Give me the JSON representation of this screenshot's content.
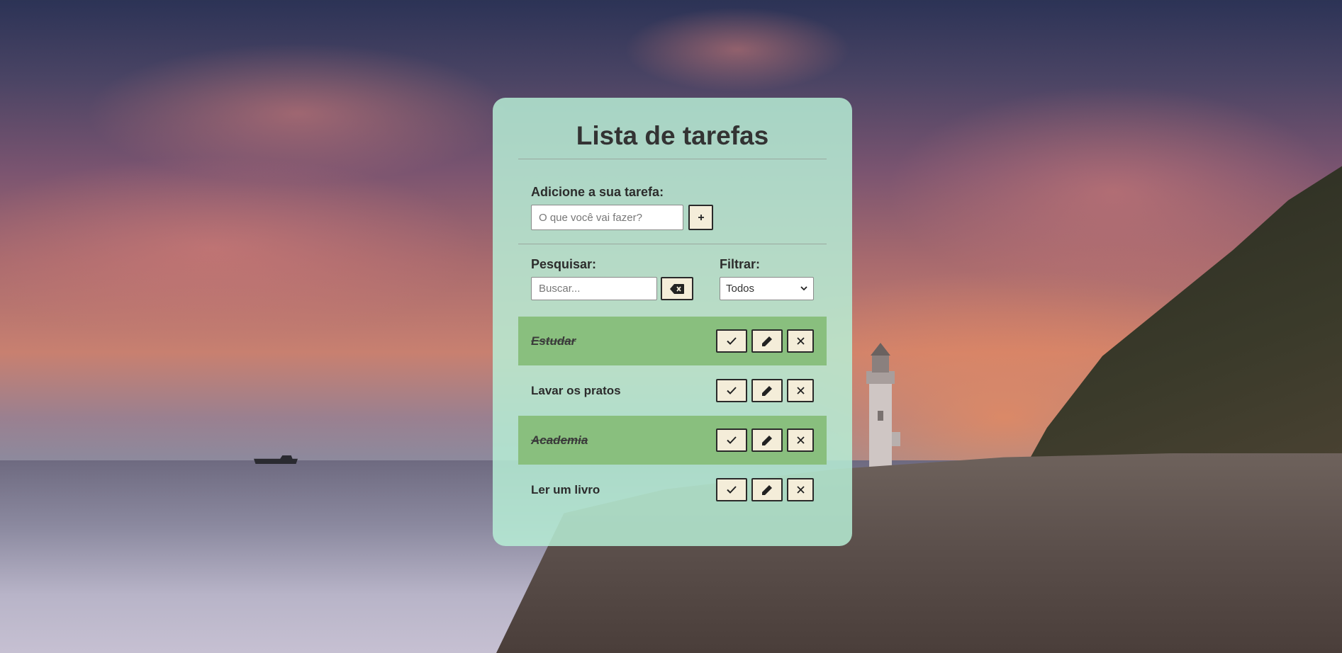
{
  "app": {
    "title": "Lista de tarefas"
  },
  "add_form": {
    "label": "Adicione a sua tarefa:",
    "placeholder": "O que você vai fazer?",
    "value": "",
    "submit_icon": "plus-icon"
  },
  "search": {
    "label": "Pesquisar:",
    "placeholder": "Buscar...",
    "value": "",
    "clear_icon": "erase-icon"
  },
  "filter": {
    "label": "Filtrar:",
    "selected": "Todos"
  },
  "todos": [
    {
      "text": "Estudar",
      "done": true
    },
    {
      "text": "Lavar os pratos",
      "done": false
    },
    {
      "text": "Academia",
      "done": true
    },
    {
      "text": "Ler um livro",
      "done": false
    }
  ],
  "colors": {
    "card_background": "#b8f0d6",
    "done_row": "#89bf7e",
    "button_background": "#f4edd9",
    "title_text": "#333333"
  }
}
